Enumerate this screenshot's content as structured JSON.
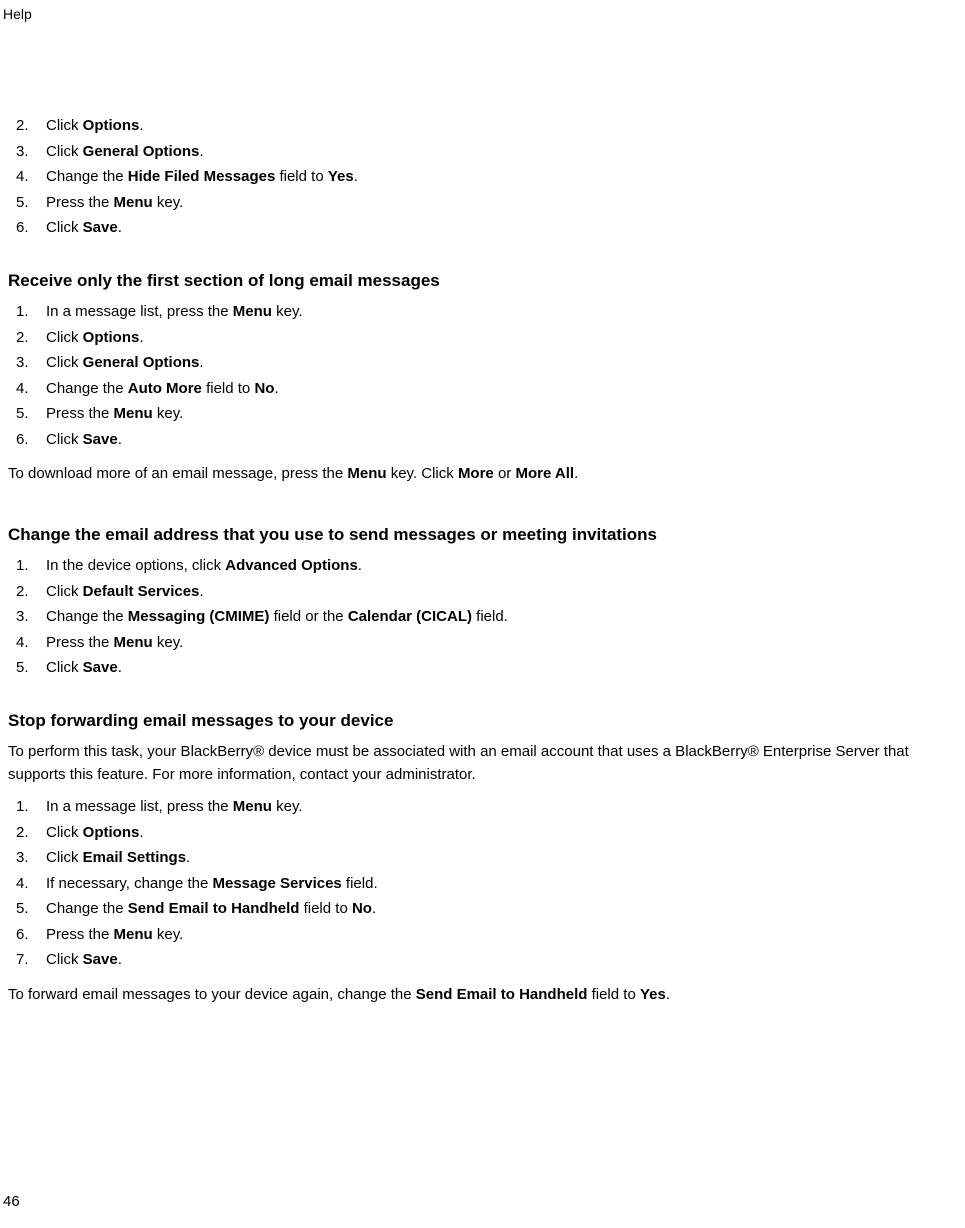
{
  "header": {
    "label": "Help"
  },
  "footer": {
    "page": "46"
  },
  "section0": {
    "items": [
      {
        "num": "2.",
        "pre": "Click ",
        "b1": "Options",
        "post": "."
      },
      {
        "num": "3.",
        "pre": "Click ",
        "b1": "General Options",
        "post": "."
      },
      {
        "num": "4.",
        "pre": "Change the ",
        "b1": "Hide Filed Messages",
        "mid": " field to ",
        "b2": "Yes",
        "post": "."
      },
      {
        "num": "5.",
        "pre": "Press the ",
        "b1": "Menu",
        "post": " key."
      },
      {
        "num": "6.",
        "pre": "Click ",
        "b1": "Save",
        "post": "."
      }
    ]
  },
  "section1": {
    "heading": "Receive only the first section of long email messages",
    "items": [
      {
        "num": "1.",
        "pre": "In a message list, press the ",
        "b1": "Menu",
        "post": " key."
      },
      {
        "num": "2.",
        "pre": "Click ",
        "b1": "Options",
        "post": "."
      },
      {
        "num": "3.",
        "pre": "Click ",
        "b1": "General Options",
        "post": "."
      },
      {
        "num": "4.",
        "pre": "Change the ",
        "b1": "Auto More",
        "mid": " field to ",
        "b2": "No",
        "post": "."
      },
      {
        "num": "5.",
        "pre": "Press the ",
        "b1": "Menu",
        "post": " key."
      },
      {
        "num": "6.",
        "pre": "Click ",
        "b1": "Save",
        "post": "."
      }
    ],
    "para": {
      "t1": "To download more of an email message, press the ",
      "b1": "Menu",
      "t2": " key. Click ",
      "b2": "More",
      "t3": " or ",
      "b3": "More All",
      "t4": "."
    }
  },
  "section2": {
    "heading": "Change the email address that you use to send messages or meeting invitations",
    "items": [
      {
        "num": "1.",
        "pre": "In the device options, click ",
        "b1": "Advanced Options",
        "post": "."
      },
      {
        "num": "2.",
        "pre": "Click ",
        "b1": "Default Services",
        "post": "."
      },
      {
        "num": "3.",
        "pre": "Change the ",
        "b1": "Messaging (CMIME)",
        "mid": " field or the ",
        "b2": "Calendar (CICAL)",
        "post": " field."
      },
      {
        "num": "4.",
        "pre": "Press the ",
        "b1": "Menu",
        "post": " key."
      },
      {
        "num": "5.",
        "pre": "Click ",
        "b1": "Save",
        "post": "."
      }
    ]
  },
  "section3": {
    "heading": "Stop forwarding email messages to your device",
    "intro": "To perform this task, your BlackBerry® device must be associated with an email account that uses a BlackBerry® Enterprise Server that supports this feature. For more information, contact your administrator.",
    "items": [
      {
        "num": "1.",
        "pre": "In a message list, press the ",
        "b1": "Menu",
        "post": " key."
      },
      {
        "num": "2.",
        "pre": "Click ",
        "b1": "Options",
        "post": "."
      },
      {
        "num": "3.",
        "pre": "Click ",
        "b1": "Email Settings",
        "post": "."
      },
      {
        "num": "4.",
        "pre": "If necessary, change the ",
        "b1": "Message Services",
        "post": " field."
      },
      {
        "num": "5.",
        "pre": "Change the ",
        "b1": "Send Email to Handheld",
        "mid": " field to ",
        "b2": "No",
        "post": "."
      },
      {
        "num": "6.",
        "pre": "Press the ",
        "b1": "Menu",
        "post": " key."
      },
      {
        "num": "7.",
        "pre": "Click ",
        "b1": "Save",
        "post": "."
      }
    ],
    "para": {
      "t1": "To forward email messages to your device again, change the ",
      "b1": "Send Email to Handheld",
      "t2": " field to ",
      "b2": "Yes",
      "t3": "."
    }
  }
}
